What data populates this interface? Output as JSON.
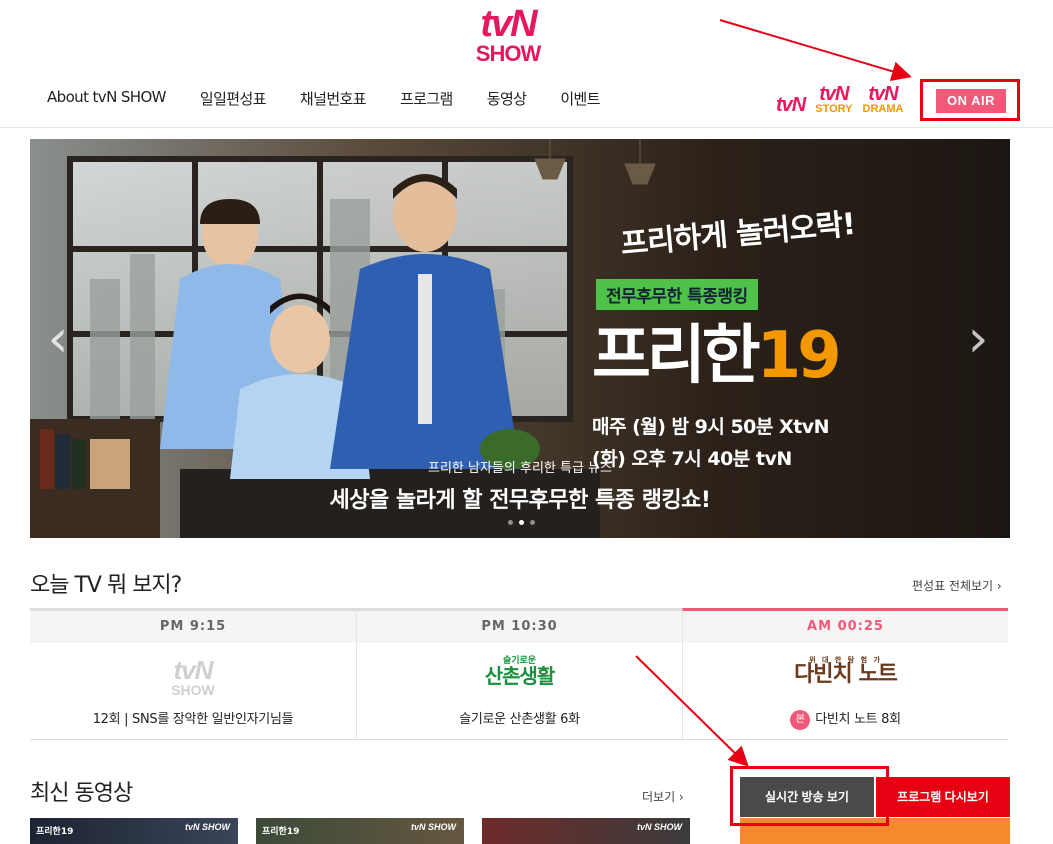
{
  "header": {
    "logo_top": "tvN",
    "logo_bottom": "SHOW",
    "nav": [
      "About tvN SHOW",
      "일일편성표",
      "채널번호표",
      "프로그램",
      "동영상",
      "이벤트"
    ],
    "channels": [
      {
        "top": "tvN",
        "sub": ""
      },
      {
        "top": "tvN",
        "sub": "STORY"
      },
      {
        "top": "tvN",
        "sub": "DRAMA"
      }
    ],
    "onair_label": "ON AIR"
  },
  "banner": {
    "poster_slogan": "프리하게 놀러오락!",
    "poster_tag": "전무후무한 특종랭킹",
    "poster_title": "프리한",
    "poster_number": "19",
    "poster_line1": "매주 (월) 밤 9시 50분 XtvN",
    "poster_line2": "(화) 오후 7시 40분 tvN",
    "subtitle": "프리한 남자들의 후리한 특급 뉴스",
    "title": "세상을 놀라게 할 전무후무한 특종 랭킹쇼!",
    "prev_icon": "‹",
    "next_icon": "›",
    "slide_count": 3,
    "active_slide": 1
  },
  "today": {
    "title": "오늘 TV 뭐 보지?",
    "more": "편성표 전체보기 ›",
    "items": [
      {
        "time": "PM 9:15",
        "art_top": "tvN",
        "art_bottom": "SHOW",
        "program": "12회 | SNS를 장악한 일반인자기님들",
        "badge": ""
      },
      {
        "time": "PM 10:30",
        "art_top": "슬기로운",
        "art_bottom": "산촌생활",
        "program": "슬기로운 산촌생활 6화",
        "badge": ""
      },
      {
        "time": "AM 00:25",
        "art_top": "위 대 한 탐 험 가",
        "art_bottom": "다빈치 노트",
        "program": "다빈치 노트 8회",
        "badge": "본"
      }
    ]
  },
  "latest": {
    "title": "최신 동영상",
    "more": "더보기 ›",
    "thumbs": [
      {
        "left": "프리한19",
        "right": "tvN SHOW"
      },
      {
        "left": "프리한19",
        "right": "tvN SHOW"
      },
      {
        "left": "",
        "right": "tvN SHOW"
      }
    ],
    "tab_live": "실시간 방송 보기",
    "tab_replay": "프로그램 다시보기"
  },
  "colors": {
    "brand_pink": "#e8175d",
    "onair_bg": "#f05a78",
    "annotation_red": "#e60012",
    "replay_red": "#e60012"
  }
}
